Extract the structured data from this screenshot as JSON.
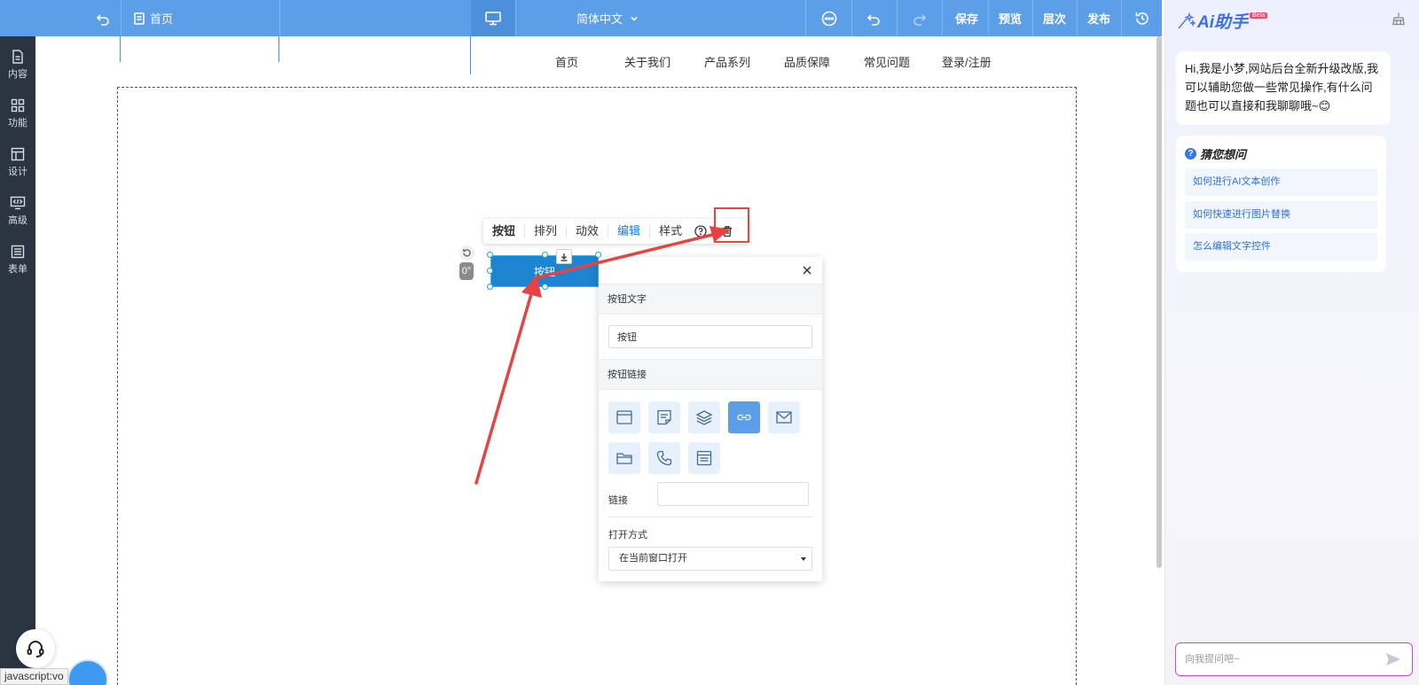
{
  "topbar": {
    "page_name": "首页",
    "language": "简体中文",
    "save": "保存",
    "preview": "预览",
    "layers": "层次",
    "publish": "发布"
  },
  "sidebar": {
    "items": [
      {
        "label": "内容",
        "icon": "document-icon"
      },
      {
        "label": "功能",
        "icon": "grid-icon"
      },
      {
        "label": "设计",
        "icon": "layout-icon"
      },
      {
        "label": "高级",
        "icon": "code-monitor-icon"
      },
      {
        "label": "表单",
        "icon": "form-icon"
      }
    ]
  },
  "site_nav": {
    "items": [
      "首页",
      "关于我们",
      "产品系列",
      "品质保障",
      "常见问题",
      "登录/注册"
    ]
  },
  "element_toolbar": {
    "items": [
      "按钮",
      "排列",
      "动效",
      "编辑",
      "样式"
    ],
    "active_index": 3
  },
  "selected_button": {
    "label": "按钮",
    "rotation": "0°"
  },
  "panel": {
    "button_text_section": "按钮文字",
    "button_text_value": "按钮",
    "button_link_section": "按钮链接",
    "link_types": [
      "window-icon",
      "note-icon",
      "layers-icon",
      "link-icon",
      "mail-icon",
      "folder-icon",
      "phone-icon",
      "list-icon"
    ],
    "active_link_type": 3,
    "link_label": "链接",
    "link_value": "",
    "open_mode_label": "打开方式",
    "open_mode_value": "在当前窗口打开"
  },
  "status_bar": {
    "url": "javascript:vo"
  },
  "ai": {
    "title": "Ai助手",
    "beta": "Beta",
    "greeting": "Hi,我是小梦,网站后台全新升级改版,我可以辅助您做一些常见操作,有什么问题也可以直接和我聊聊哦~😊",
    "guess_title": "猜您想问",
    "guesses": [
      "如何进行AI文本创作",
      "如何快速进行图片替换",
      "怎么编辑文字控件"
    ],
    "input_placeholder": "向我提问吧~"
  },
  "colors": {
    "topbar": "#5c9ee8",
    "sidebar": "#2b3441",
    "button": "#1c84d0",
    "annotation": "#e64343",
    "active_link": "#5c9ee8"
  }
}
